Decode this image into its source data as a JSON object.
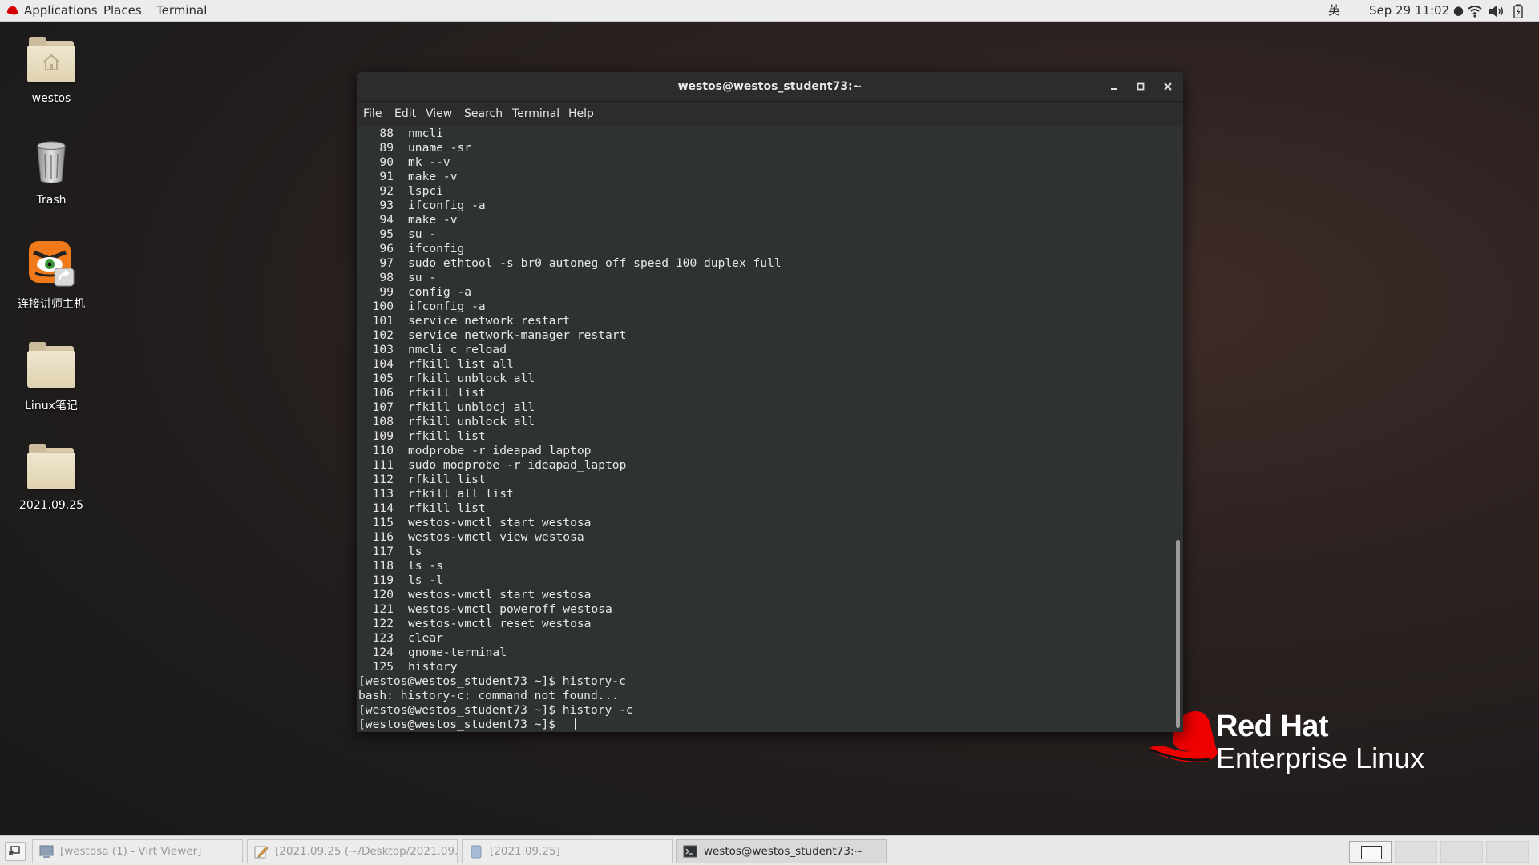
{
  "topbar": {
    "applications": "Applications",
    "places": "Places",
    "terminal": "Terminal",
    "input_method": "英",
    "clock": "Sep 29 11:02 ●"
  },
  "desktop_icons": [
    {
      "label": "westos",
      "icon": "home-folder-icon"
    },
    {
      "label": "Trash",
      "icon": "trash-icon"
    },
    {
      "label": "连接讲师主机",
      "icon": "tiger-launcher-icon"
    },
    {
      "label": "Linux笔记",
      "icon": "folder-icon"
    },
    {
      "label": "2021.09.25",
      "icon": "folder-icon"
    }
  ],
  "window": {
    "title": "westos@westos_student73:~",
    "menu": [
      "File",
      "Edit",
      "View",
      "Search",
      "Terminal",
      "Help"
    ]
  },
  "terminal": {
    "history": [
      {
        "n": "88",
        "cmd": "nmcli"
      },
      {
        "n": "89",
        "cmd": "uname -sr"
      },
      {
        "n": "90",
        "cmd": "mk --v"
      },
      {
        "n": "91",
        "cmd": "make -v"
      },
      {
        "n": "92",
        "cmd": "lspci"
      },
      {
        "n": "93",
        "cmd": "ifconfig -a"
      },
      {
        "n": "94",
        "cmd": "make -v"
      },
      {
        "n": "95",
        "cmd": "su -"
      },
      {
        "n": "96",
        "cmd": "ifconfig"
      },
      {
        "n": "97",
        "cmd": "sudo ethtool -s br0 autoneg off speed 100 duplex full"
      },
      {
        "n": "98",
        "cmd": "su -"
      },
      {
        "n": "99",
        "cmd": "config -a"
      },
      {
        "n": "100",
        "cmd": "ifconfig -a"
      },
      {
        "n": "101",
        "cmd": "service network restart"
      },
      {
        "n": "102",
        "cmd": "service network-manager restart"
      },
      {
        "n": "103",
        "cmd": "nmcli c reload"
      },
      {
        "n": "104",
        "cmd": "rfkill list all"
      },
      {
        "n": "105",
        "cmd": "rfkill unblock all"
      },
      {
        "n": "106",
        "cmd": "rfkill list"
      },
      {
        "n": "107",
        "cmd": "rfkill unblocj all"
      },
      {
        "n": "108",
        "cmd": "rfkill unblock all"
      },
      {
        "n": "109",
        "cmd": "rfkill list"
      },
      {
        "n": "110",
        "cmd": "modprobe -r ideapad_laptop"
      },
      {
        "n": "111",
        "cmd": "sudo modprobe -r ideapad_laptop"
      },
      {
        "n": "112",
        "cmd": "rfkill list"
      },
      {
        "n": "113",
        "cmd": "rfkill all list"
      },
      {
        "n": "114",
        "cmd": "rfkill list"
      },
      {
        "n": "115",
        "cmd": "westos-vmctl start westosa"
      },
      {
        "n": "116",
        "cmd": "westos-vmctl view westosa"
      },
      {
        "n": "117",
        "cmd": "ls"
      },
      {
        "n": "118",
        "cmd": "ls -s"
      },
      {
        "n": "119",
        "cmd": "ls -l"
      },
      {
        "n": "120",
        "cmd": "westos-vmctl start westosa"
      },
      {
        "n": "121",
        "cmd": "westos-vmctl poweroff westosa"
      },
      {
        "n": "122",
        "cmd": "westos-vmctl reset westosa"
      },
      {
        "n": "123",
        "cmd": "clear"
      },
      {
        "n": "124",
        "cmd": "gnome-terminal"
      },
      {
        "n": "125",
        "cmd": "history"
      }
    ],
    "output": [
      "[westos@westos_student73 ~]$ history-c",
      "bash: history-c: command not found...",
      "[westos@westos_student73 ~]$ history -c"
    ],
    "prompt": "[westos@westos_student73 ~]$ "
  },
  "branding": {
    "line1": "Red Hat",
    "line2": "Enterprise Linux",
    "accent": "#ee0000"
  },
  "taskbar": {
    "tasks": [
      {
        "label": "[westosa (1) - Virt Viewer]",
        "icon": "virt-viewer-icon",
        "active": false
      },
      {
        "label": "[2021.09.25 (~/Desktop/2021.09.2...",
        "icon": "text-editor-icon",
        "active": false
      },
      {
        "label": "[2021.09.25]",
        "icon": "file-manager-icon",
        "active": false
      },
      {
        "label": "westos@westos_student73:~",
        "icon": "terminal-icon",
        "active": true
      }
    ],
    "workspaces": 4,
    "current_workspace": 1
  }
}
